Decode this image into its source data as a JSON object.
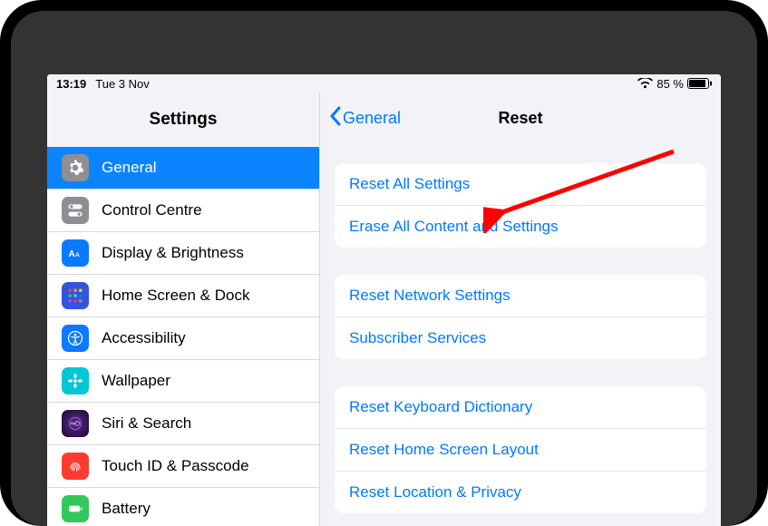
{
  "status": {
    "time": "13:19",
    "date": "Tue 3 Nov",
    "battery_pct": "85 %"
  },
  "sidebar": {
    "title": "Settings",
    "items": [
      {
        "label": "General"
      },
      {
        "label": "Control Centre"
      },
      {
        "label": "Display & Brightness"
      },
      {
        "label": "Home Screen & Dock"
      },
      {
        "label": "Accessibility"
      },
      {
        "label": "Wallpaper"
      },
      {
        "label": "Siri & Search"
      },
      {
        "label": "Touch ID & Passcode"
      },
      {
        "label": "Battery"
      }
    ]
  },
  "detail": {
    "back_label": "General",
    "title": "Reset",
    "groups": [
      {
        "items": [
          {
            "label": "Reset All Settings"
          },
          {
            "label": "Erase All Content and Settings"
          }
        ]
      },
      {
        "items": [
          {
            "label": "Reset Network Settings"
          },
          {
            "label": "Subscriber Services"
          }
        ]
      },
      {
        "items": [
          {
            "label": "Reset Keyboard Dictionary"
          },
          {
            "label": "Reset Home Screen Layout"
          },
          {
            "label": "Reset Location & Privacy"
          }
        ]
      }
    ]
  }
}
